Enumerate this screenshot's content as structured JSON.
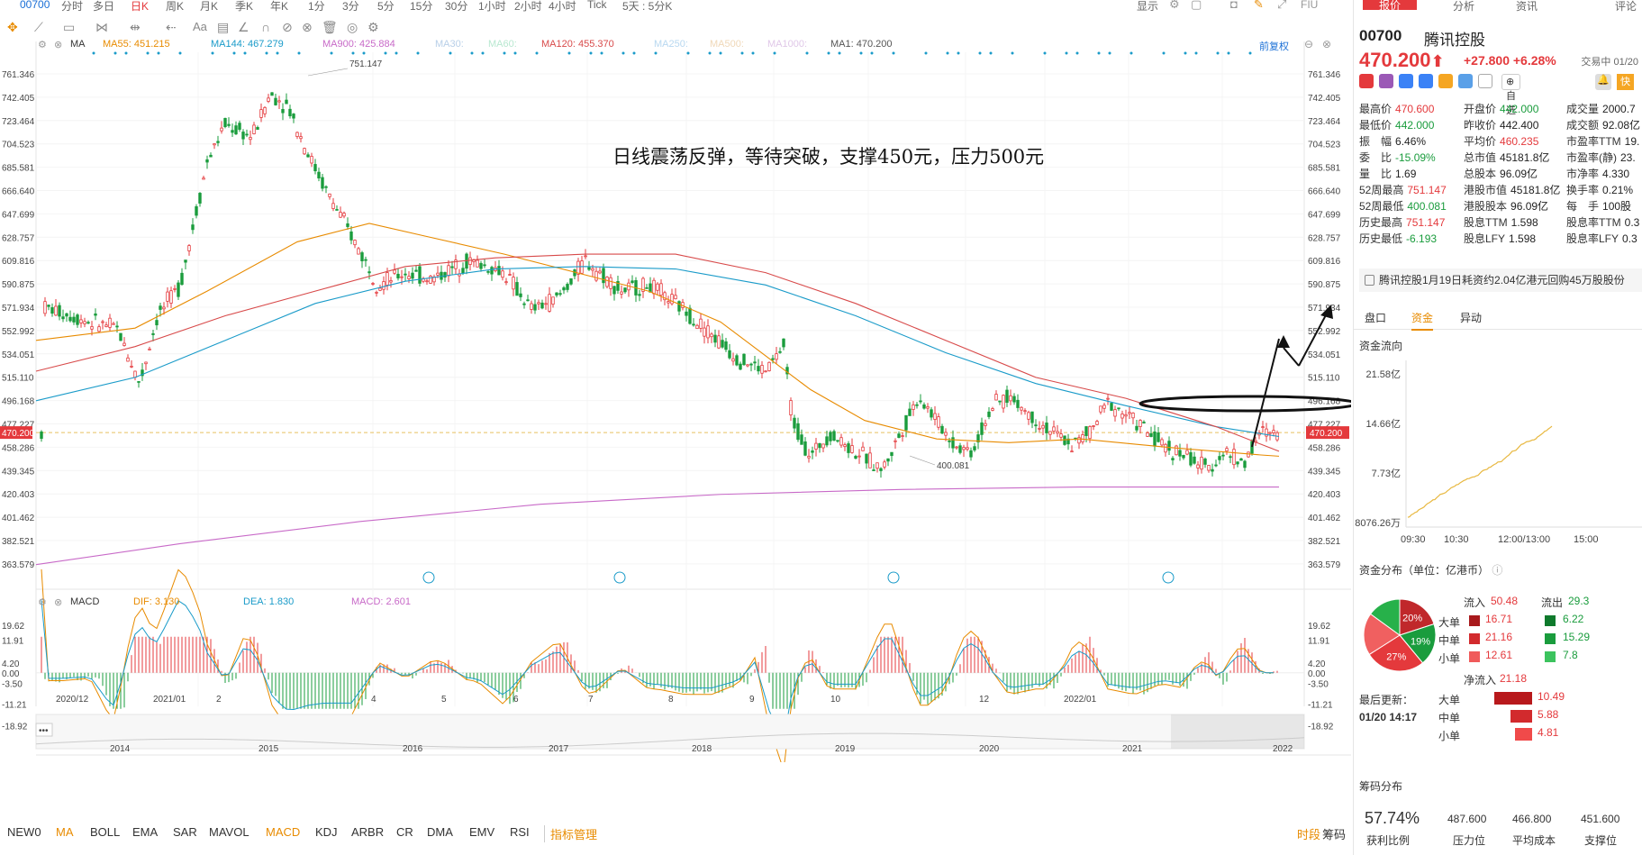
{
  "toolbar": {
    "code": "00700",
    "periods": [
      "分时",
      "多日",
      "日K",
      "周K",
      "月K",
      "季K",
      "年K",
      "1分",
      "3分",
      "5分",
      "15分",
      "30分",
      "1小时",
      "2小时",
      "4小时",
      "Tick",
      "5天 : 5分K"
    ],
    "active_period": "日K",
    "right": [
      "显示",
      "FIU"
    ]
  },
  "legend": {
    "indicator": "MA",
    "items": [
      {
        "text": "MA55: 451.215",
        "color": "#e88b00"
      },
      {
        "text": "MA144: 467.279",
        "color": "#1a9bc9"
      },
      {
        "text": "MA900: 425.884",
        "color": "#c86ac8"
      },
      {
        "text": "MA30:",
        "color": "#b8cfe8"
      },
      {
        "text": "MA60:",
        "color": "#b8e8d0"
      },
      {
        "text": "MA120: 455.370",
        "color": "#d84a4a"
      },
      {
        "text": "MA250:",
        "color": "#b8d8f0"
      },
      {
        "text": "MA500:",
        "color": "#f0d8b8"
      },
      {
        "text": "MA1000:",
        "color": "#e0c8e8"
      },
      {
        "text": "MA1: 470.200",
        "color": "#555555"
      }
    ],
    "adjust": "前复权"
  },
  "price_axis": [
    "761.346",
    "742.405",
    "723.464",
    "704.523",
    "685.581",
    "666.640",
    "647.699",
    "628.757",
    "609.816",
    "590.875",
    "571.934",
    "552.992",
    "534.051",
    "515.110",
    "496.168",
    "477.227",
    "458.286",
    "439.345",
    "420.403",
    "401.462",
    "382.521",
    "363.579"
  ],
  "current_price_label": "470.200",
  "high_label": "751.147",
  "low_label": "400.081",
  "annotation": "日线震荡反弹，等待突破，支撑450元，压力500元",
  "macd_legend": {
    "name": "MACD",
    "dif": "DIF: 3.130",
    "dea": "DEA: 1.830",
    "macd": "MACD: 2.601"
  },
  "macd_axis": [
    "19.62",
    "11.91",
    "4.20",
    "0.00",
    "-3.50",
    "-11.21",
    "-18.92"
  ],
  "month_axis": [
    "2020/12",
    "2021/01",
    "2",
    "4",
    "5",
    "6",
    "7",
    "8",
    "9",
    "10",
    "12",
    "2022/01"
  ],
  "year_axis": [
    "2014",
    "2015",
    "2016",
    "2017",
    "2018",
    "2019",
    "2020",
    "2021",
    "2022"
  ],
  "indicator_tabs": [
    "NEW0",
    "MA",
    "BOLL",
    "EMA",
    "SAR",
    "MAVOL",
    "MACD",
    "KDJ",
    "ARBR",
    "CR",
    "DMA",
    "EMV",
    "RSI",
    "指标管理"
  ],
  "bottom_right": [
    "时段",
    "筹码"
  ],
  "panel": {
    "tabs": [
      "报价",
      "分析",
      "资讯",
      "评论"
    ],
    "code": "00700",
    "name": "腾讯控股",
    "price": "470.200",
    "change": "+27.800  +6.28%",
    "status": "交易中 01/20",
    "fav": "自选",
    "quick": "快捷",
    "quotes": [
      [
        "最高价",
        "470.600",
        "red",
        "开盘价",
        "442.000",
        "green",
        "成交量",
        "2000.7",
        "plain"
      ],
      [
        "最低价",
        "442.000",
        "green",
        "昨收价",
        "442.400",
        "plain",
        "成交额",
        "92.08亿",
        "plain"
      ],
      [
        "振　幅",
        "6.46%",
        "plain",
        "平均价",
        "460.235",
        "red",
        "市盈率TTM",
        "19.",
        "plain"
      ],
      [
        "委　比",
        "-15.09%",
        "green",
        "总市值",
        "45181.8亿",
        "plain",
        "市盈率(静)",
        "23.",
        "plain"
      ],
      [
        "量　比",
        "1.69",
        "plain",
        "总股本",
        "96.09亿",
        "plain",
        "市净率",
        "4.330",
        "plain"
      ],
      [
        "52周最高",
        "751.147",
        "red",
        "港股市值",
        "45181.8亿",
        "plain",
        "换手率",
        "0.21%",
        "plain"
      ],
      [
        "52周最低",
        "400.081",
        "green",
        "港股股本",
        "96.09亿",
        "plain",
        "每　手",
        "100股",
        "plain"
      ],
      [
        "历史最高",
        "751.147",
        "red",
        "股息TTM",
        "1.598",
        "plain",
        "股息率TTM",
        "0.3",
        "plain"
      ],
      [
        "历史最低",
        "-6.193",
        "green",
        "股息LFY",
        "1.598",
        "plain",
        "股息率LFY",
        "0.3",
        "plain"
      ]
    ],
    "news": "腾讯控股1月19日耗资约2.04亿港元回购45万股股份",
    "sub_tabs": [
      "盘口",
      "资金",
      "异动"
    ],
    "active_sub_tab": "资金",
    "flow_title": "资金流向",
    "flow_axis": [
      "21.58亿",
      "14.66亿",
      "7.73亿",
      "8076.26万"
    ],
    "flow_time": [
      "09:30",
      "10:30",
      "12:00/13:00",
      "15:00"
    ],
    "dist_title": "资金分布（单位：亿港币）",
    "pie": [
      {
        "label": "20%",
        "value": 20,
        "color": "#c0282b"
      },
      {
        "label": "19%",
        "value": 19,
        "color": "#1a9c3d"
      },
      {
        "label": "27%",
        "value": 27,
        "color": "#e4393c"
      },
      {
        "label": "",
        "value": 19,
        "color": "#f06060"
      },
      {
        "label": "",
        "value": 15,
        "color": "#27b14a"
      }
    ],
    "inflow_label": "流入",
    "inflow_total": "50.48",
    "outflow_label": "流出",
    "outflow_total": "29.3",
    "rows": [
      {
        "name": "大单",
        "in": "16.71",
        "out": "6.22"
      },
      {
        "name": "中单",
        "in": "21.16",
        "out": "15.29"
      },
      {
        "name": "小单",
        "in": "12.61",
        "out": "7.8"
      }
    ],
    "net_label": "净流入",
    "net_total": "21.18",
    "net_rows": [
      {
        "name": "大单",
        "value": "10.49",
        "ratio": 1.0
      },
      {
        "name": "中单",
        "value": "5.88",
        "ratio": 0.56
      },
      {
        "name": "小单",
        "value": "4.81",
        "ratio": 0.46
      }
    ],
    "updated_label": "最后更新：",
    "updated_time": "01/20 14:17",
    "chip_title": "筹码分布",
    "chip_ratio": "57.74%",
    "chip_ratio_label": "获利比例",
    "chip_values": [
      {
        "value": "487.600",
        "label": "压力位"
      },
      {
        "value": "466.800",
        "label": "平均成本"
      },
      {
        "value": "451.600",
        "label": "支撑位"
      }
    ]
  },
  "colors": {
    "up": "#e4393c",
    "down": "#1a9c3d",
    "accent": "#e88b00"
  }
}
